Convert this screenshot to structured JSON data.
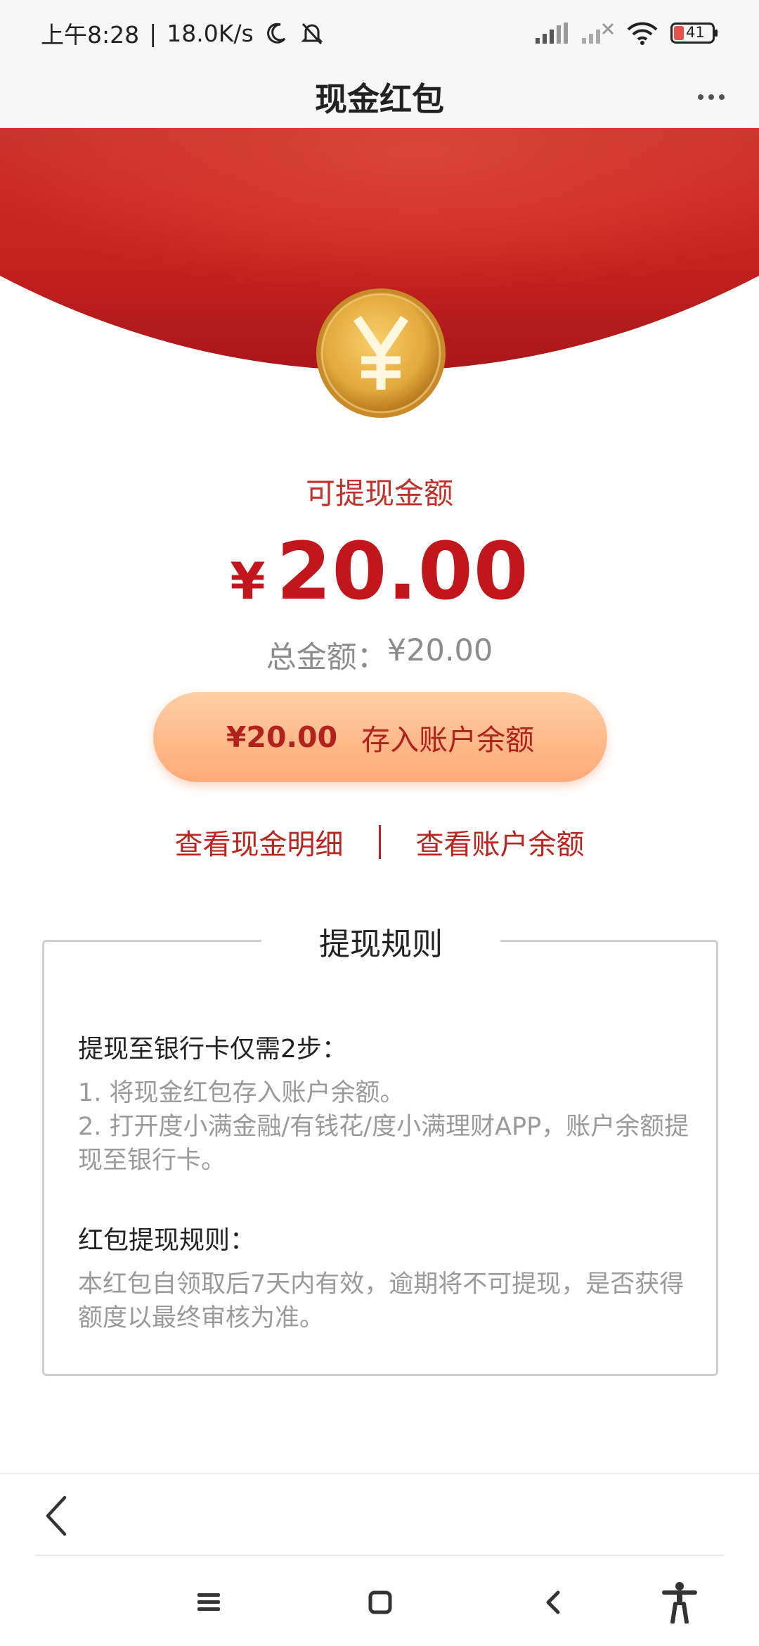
{
  "status_bar": {
    "time": "上午8:28",
    "separator": "|",
    "speed": "18.0K/s",
    "battery": "41",
    "icons": [
      "moon-icon",
      "bell-off-icon",
      "signal-icon",
      "signal-no-service-icon",
      "wifi-icon",
      "battery-icon"
    ]
  },
  "header": {
    "title": "现金红包",
    "more_icon": "more-dots-icon"
  },
  "main": {
    "coin_icon": "yuan-coin-icon",
    "withdrawable_label": "可提现金额",
    "currency_symbol": "¥",
    "amount": "20.00",
    "total_label": "总金额：",
    "total_value": "¥20.00",
    "deposit_button": {
      "amount": "¥20.00",
      "label": "存入账户余额"
    },
    "links": {
      "cash_details": "查看现金明细",
      "account_balance": "查看账户余额"
    }
  },
  "rules": {
    "title": "提现规则",
    "section1_heading": "提现至银行卡仅需2步：",
    "section1_step1": "1. 将现金红包存入账户余额。",
    "section1_step2": "2. 打开度小满金融/有钱花/度小满理财APP，账户余额提现至银行卡。",
    "section2_heading": "红包提现规则：",
    "section2_text": "本红包自领取后7天内有效，逾期将不可提现，是否获得额度以最终审核为准。"
  },
  "browser_nav": {
    "back_icon": "chevron-left-icon"
  },
  "system_nav": {
    "icons": [
      "menu-icon",
      "home-square-icon",
      "back-icon",
      "accessibility-icon"
    ]
  },
  "colors": {
    "banner_red": "#c4211f",
    "amount_red": "#c0161c",
    "link_red": "#b8261f",
    "button_peach": "#ffb98a",
    "coin_gold": "#e3a93c"
  }
}
